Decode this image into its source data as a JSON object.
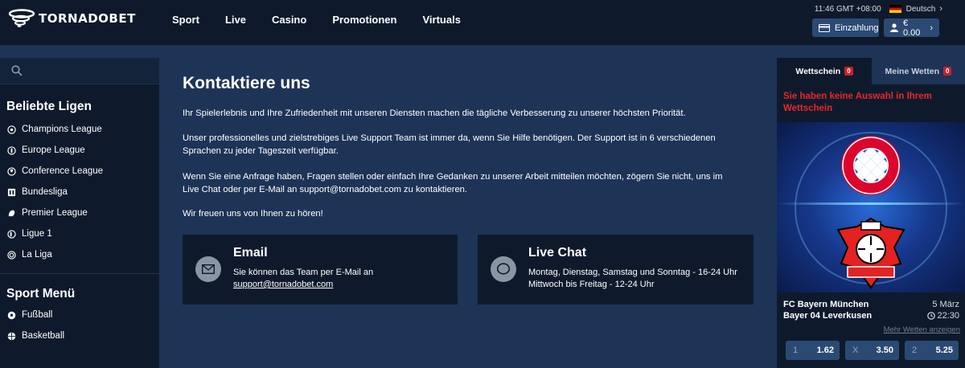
{
  "header": {
    "logo_text": "TORNADOBET",
    "nav": [
      "Sport",
      "Live",
      "Casino",
      "Promotionen",
      "Virtuals"
    ],
    "time": "11:46 GMT +08:00",
    "language": "Deutsch",
    "deposit_label": "Einzahlung",
    "balance_label": "€ 0.00"
  },
  "sidebar": {
    "search_placeholder": "",
    "leagues_title": "Beliebte Ligen",
    "leagues": [
      {
        "label": "Champions League",
        "icon": "football-icon"
      },
      {
        "label": "Europe League",
        "icon": "trophy-icon"
      },
      {
        "label": "Conference League",
        "icon": "trophy-icon"
      },
      {
        "label": "Bundesliga",
        "icon": "bundesliga-icon"
      },
      {
        "label": "Premier League",
        "icon": "lion-icon"
      },
      {
        "label": "Ligue 1",
        "icon": "ligue1-icon"
      },
      {
        "label": "La Liga",
        "icon": "laliga-icon"
      }
    ],
    "sports_title": "Sport Menü",
    "sports": [
      {
        "label": "Fußball",
        "icon": "football-icon"
      },
      {
        "label": "Basketball",
        "icon": "basketball-icon"
      }
    ]
  },
  "main": {
    "title": "Kontaktiere uns",
    "p1": "Ihr Spielerlebnis und Ihre Zufriedenheit mit unseren Diensten machen die tägliche Verbesserung zu unserer höchsten Priorität.",
    "p2": "Unser professionelles und zielstrebiges Live Support Team ist immer da, wenn Sie Hilfe benötigen. Der Support ist in 6 verschiedenen Sprachen zu jeder Tageszeit verfügbar.",
    "p3": "Wenn Sie eine Anfrage haben, Fragen stellen oder einfach Ihre Gedanken zu unserer Arbeit mitteilen möchten, zögern Sie nicht, uns im Live Chat oder per E-Mail an  support@tornadobet.com  zu kontaktieren.",
    "p4": "Wir freuen uns von Ihnen zu hören!",
    "email_card": {
      "title": "Email",
      "text": "Sie können das Team per E-Mail an",
      "link": "support@tornadobet.com"
    },
    "chat_card": {
      "title": "Live Chat",
      "line1": "Montag, Dienstag, Samstag und Sonntag - 16-24 Uhr",
      "line2": "Mittwoch bis Freitag - 12-24 Uhr"
    }
  },
  "betslip": {
    "tab_slip": "Wettschein",
    "tab_slip_count": "0",
    "tab_mybets": "Meine Wetten",
    "tab_mybets_count": "0",
    "empty_msg": "Sie haben keine Auswahl in Ihrem Wettschein",
    "home_team": "FC Bayern München",
    "away_team": "Bayer 04 Leverkusen",
    "date": "5 März",
    "time": "22:30",
    "more_bets": "Mehr Wetten anzeigen",
    "odds": [
      {
        "label": "1",
        "value": "1.62"
      },
      {
        "label": "X",
        "value": "3.50"
      },
      {
        "label": "2",
        "value": "5.25"
      }
    ]
  },
  "colors": {
    "header_bg": "#0e1a2c",
    "page_bg": "#1d3457",
    "accent_button": "#2b4a73",
    "alert_red": "#e8262c"
  }
}
